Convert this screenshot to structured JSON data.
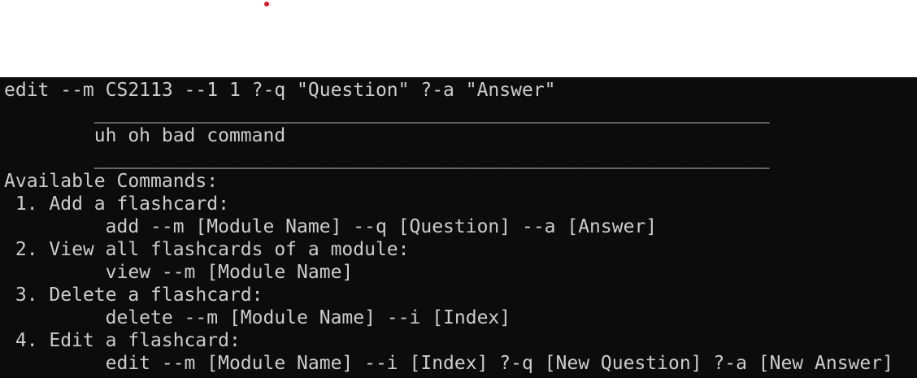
{
  "terminal": {
    "colors": {
      "background": "#0c0c0c",
      "foreground": "#cccccc"
    },
    "lines": [
      "edit --m CS2113 --1 1 ?-q \"Question\" ?-a \"Answer\"",
      "        ____________________________________________________________",
      "        uh oh bad command",
      "        ____________________________________________________________",
      "Available Commands:",
      " 1. Add a flashcard:",
      "         add --m [Module Name] --q [Question] --a [Answer]",
      " 2. View all flashcards of a module:",
      "         view --m [Module Name]",
      " 3. Delete a flashcard:",
      "         delete --m [Module Name] --i [Index]",
      " 4. Edit a flashcard:",
      "         edit --m [Module Name] --i [Index] ?-q [New Question] ?-a [New Answer]"
    ]
  }
}
